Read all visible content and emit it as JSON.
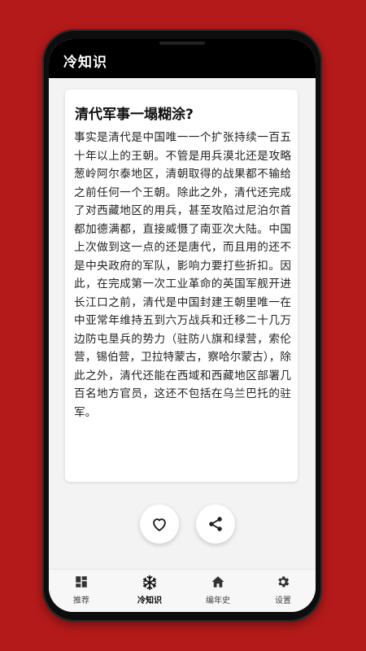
{
  "app": {
    "title": "冷知识"
  },
  "card": {
    "title": "清代军事一塌糊涂?",
    "body": "事实是清代是中国唯一一个扩张持续一百五十年以上的王朝。不管是用兵漠北还是攻略葱岭阿尔泰地区，清朝取得的战果都不输给之前任何一个王朝。除此之外，清代还完成了对西藏地区的用兵，甚至攻陷过尼泊尔首都加德满都，直接威慑了南亚次大陆。中国上次做到这一点的还是唐代，而且用的还不是中央政府的军队，影响力要打些折扣。因此，在完成第一次工业革命的英国军舰开进长江口之前，清代是中国封建王朝里唯一在中亚常年维持五到六万战兵和迁移二十几万边防屯垦兵的势力（驻防八旗和绿营，索伦营，锡伯营，卫拉特蒙古，察哈尔蒙古），除此之外，清代还能在西域和西藏地区部署几百名地方官员，这还不包括在乌兰巴托的驻军。"
  },
  "actions": {
    "like_icon": "heart-outline-icon",
    "share_icon": "share-icon"
  },
  "nav": {
    "items": [
      {
        "label": "推荐",
        "icon": "dashboard-icon"
      },
      {
        "label": "冷知识",
        "icon": "snowflake-icon"
      },
      {
        "label": "编年史",
        "icon": "home-icon"
      },
      {
        "label": "设置",
        "icon": "gear-icon"
      }
    ],
    "active_index": 1
  },
  "colors": {
    "background": "#b51a1a",
    "appbar": "#000000",
    "screen": "#f3f3f3"
  }
}
